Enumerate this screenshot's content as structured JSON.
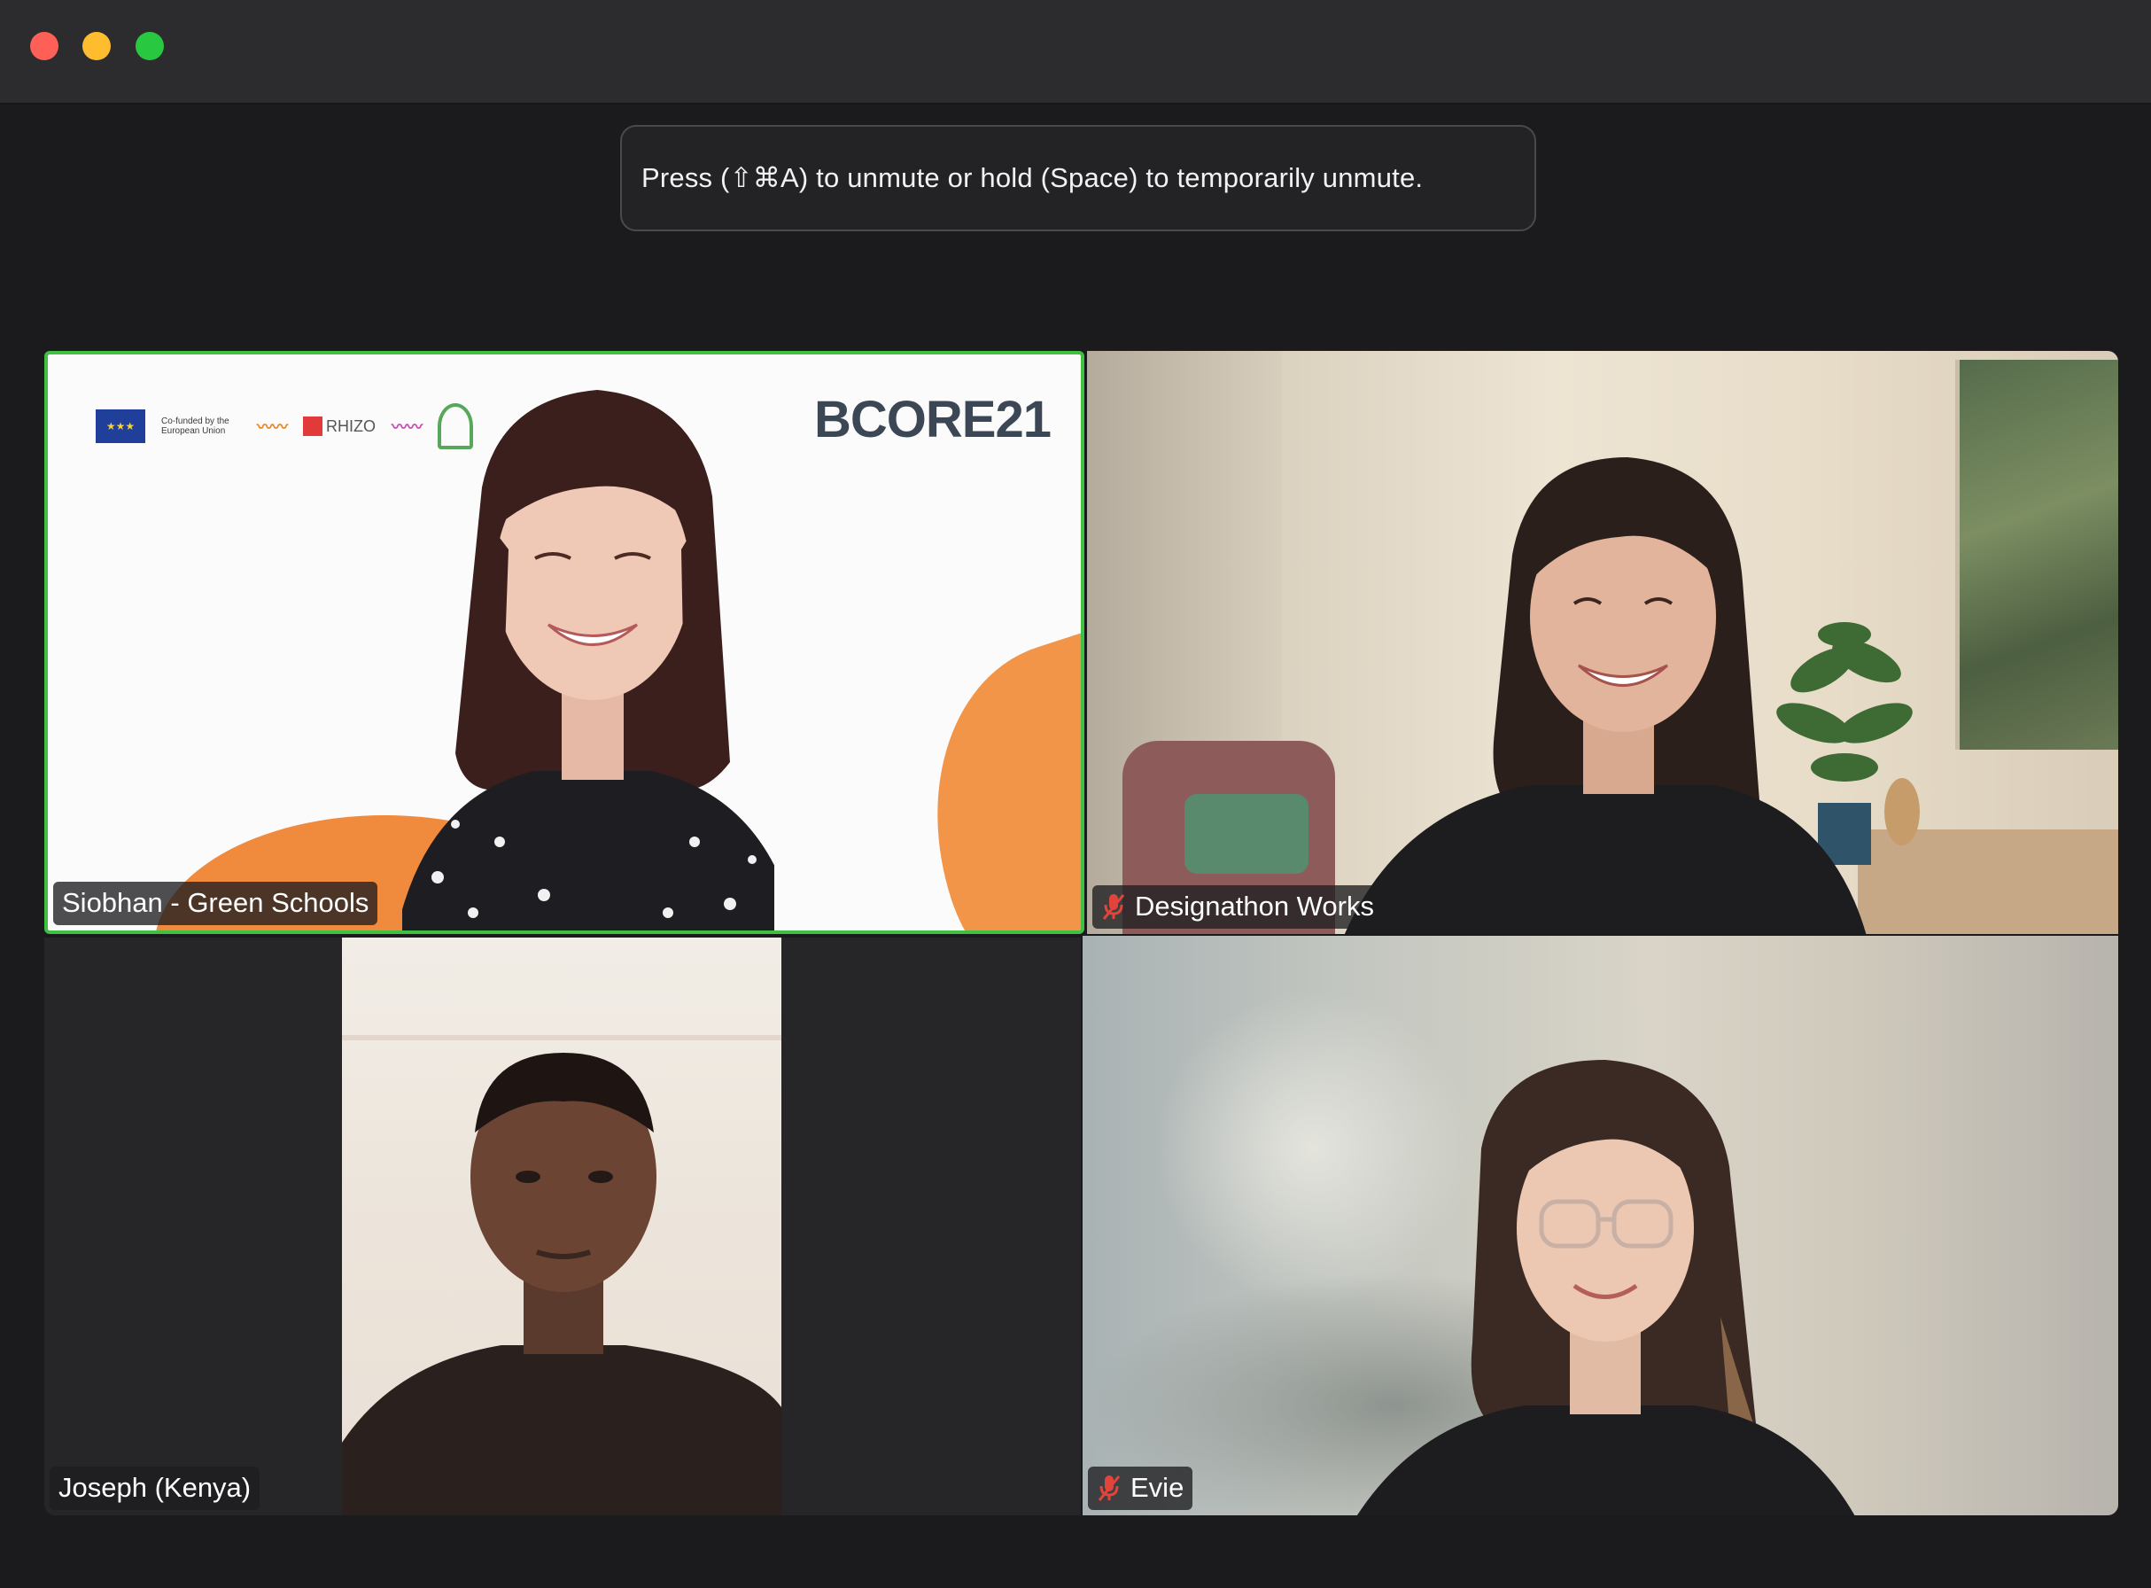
{
  "window": {
    "controls": [
      "close",
      "minimize",
      "maximize"
    ]
  },
  "toast": {
    "text": "Press (⇧⌘A) to unmute or hold (Space) to temporarily unmute."
  },
  "participants": [
    {
      "name": "Siobhan - Green Schools",
      "muted": false,
      "active_speaker": true,
      "background": {
        "brand_text": "BCORE21",
        "logo_caption": "Co-funded by the European Union",
        "logo_rhizo": "RHIZO"
      }
    },
    {
      "name": "Designathon Works",
      "muted": true,
      "active_speaker": false
    },
    {
      "name": "Joseph (Kenya)",
      "muted": false,
      "active_speaker": false
    },
    {
      "name": "Evie",
      "muted": true,
      "active_speaker": false
    }
  ],
  "colors": {
    "active_border": "#3fc040",
    "mute_icon": "#e0443c",
    "background": "#1b1b1d"
  }
}
